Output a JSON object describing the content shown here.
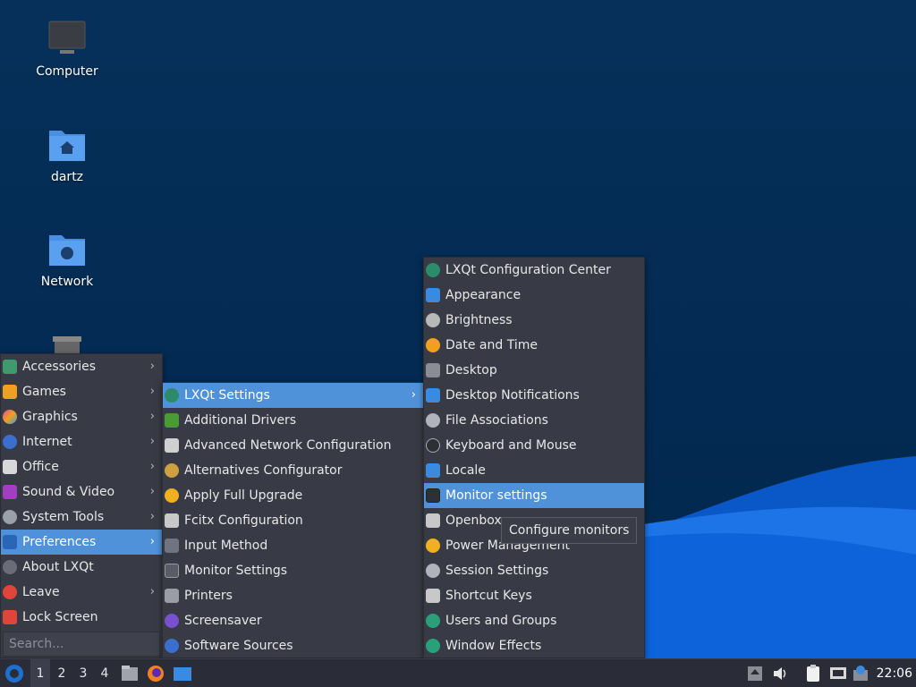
{
  "desktop": {
    "icons": [
      {
        "label": "Computer",
        "icon": "computer-icon"
      },
      {
        "label": "dartz",
        "icon": "home-folder-icon"
      },
      {
        "label": "Network",
        "icon": "network-folder-icon"
      },
      {
        "label": "",
        "icon": "trash-icon"
      }
    ]
  },
  "main_menu": {
    "items": [
      {
        "label": "Accessories",
        "icon": "accessories-icon",
        "submenu": true
      },
      {
        "label": "Games",
        "icon": "games-icon",
        "submenu": true
      },
      {
        "label": "Graphics",
        "icon": "graphics-icon",
        "submenu": true
      },
      {
        "label": "Internet",
        "icon": "internet-icon",
        "submenu": true
      },
      {
        "label": "Office",
        "icon": "office-icon",
        "submenu": true
      },
      {
        "label": "Sound & Video",
        "icon": "sound-video-icon",
        "submenu": true
      },
      {
        "label": "System Tools",
        "icon": "system-tools-icon",
        "submenu": true
      },
      {
        "label": "Preferences",
        "icon": "preferences-icon",
        "submenu": true,
        "active": true
      },
      {
        "label": "About LXQt",
        "icon": "info-icon",
        "submenu": false
      },
      {
        "label": "Leave",
        "icon": "leave-icon",
        "submenu": true
      },
      {
        "label": "Lock Screen",
        "icon": "lock-icon",
        "submenu": false
      }
    ],
    "search_placeholder": "Search..."
  },
  "preferences_menu": {
    "items": [
      {
        "label": "LXQt Settings",
        "icon": "lxqt-settings-icon",
        "submenu": true,
        "active": true
      },
      {
        "label": "Additional Drivers",
        "icon": "drivers-icon"
      },
      {
        "label": "Advanced Network Configuration",
        "icon": "network-config-icon"
      },
      {
        "label": "Alternatives Configurator",
        "icon": "alternatives-icon"
      },
      {
        "label": "Apply Full Upgrade",
        "icon": "upgrade-icon"
      },
      {
        "label": "Fcitx Configuration",
        "icon": "keyboard-icon"
      },
      {
        "label": "Input Method",
        "icon": "input-method-icon"
      },
      {
        "label": "Monitor Settings",
        "icon": "monitor-icon"
      },
      {
        "label": "Printers",
        "icon": "printer-icon"
      },
      {
        "label": "Screensaver",
        "icon": "screensaver-icon"
      },
      {
        "label": "Software Sources",
        "icon": "software-sources-icon"
      }
    ]
  },
  "lxqt_settings_menu": {
    "items": [
      {
        "label": "LXQt Configuration Center",
        "icon": "lxqt-config-center-icon"
      },
      {
        "label": "Appearance",
        "icon": "appearance-icon"
      },
      {
        "label": "Brightness",
        "icon": "brightness-icon"
      },
      {
        "label": "Date and Time",
        "icon": "clock-icon"
      },
      {
        "label": "Desktop",
        "icon": "desktop-icon"
      },
      {
        "label": "Desktop Notifications",
        "icon": "notifications-icon"
      },
      {
        "label": "File Associations",
        "icon": "file-associations-icon"
      },
      {
        "label": "Keyboard and Mouse",
        "icon": "mouse-icon"
      },
      {
        "label": "Locale",
        "icon": "locale-icon"
      },
      {
        "label": "Monitor settings",
        "icon": "monitor-icon",
        "active": true
      },
      {
        "label": "Openbox",
        "icon": "openbox-icon"
      },
      {
        "label": "Power Management",
        "icon": "power-icon"
      },
      {
        "label": "Session Settings",
        "icon": "session-icon"
      },
      {
        "label": "Shortcut Keys",
        "icon": "shortcut-keys-icon"
      },
      {
        "label": "Users and Groups",
        "icon": "users-icon"
      },
      {
        "label": "Window Effects",
        "icon": "window-effects-icon"
      }
    ]
  },
  "tooltip": "Configure monitors",
  "taskbar": {
    "workspaces": [
      "1",
      "2",
      "3",
      "4"
    ],
    "active_workspace": "1",
    "clock": "22:06"
  },
  "colors": {
    "menu_bg": "#383a45",
    "highlight": "#4f92d9",
    "desktop_bg": "#03264a",
    "taskbar_bg": "#2a2d37"
  }
}
